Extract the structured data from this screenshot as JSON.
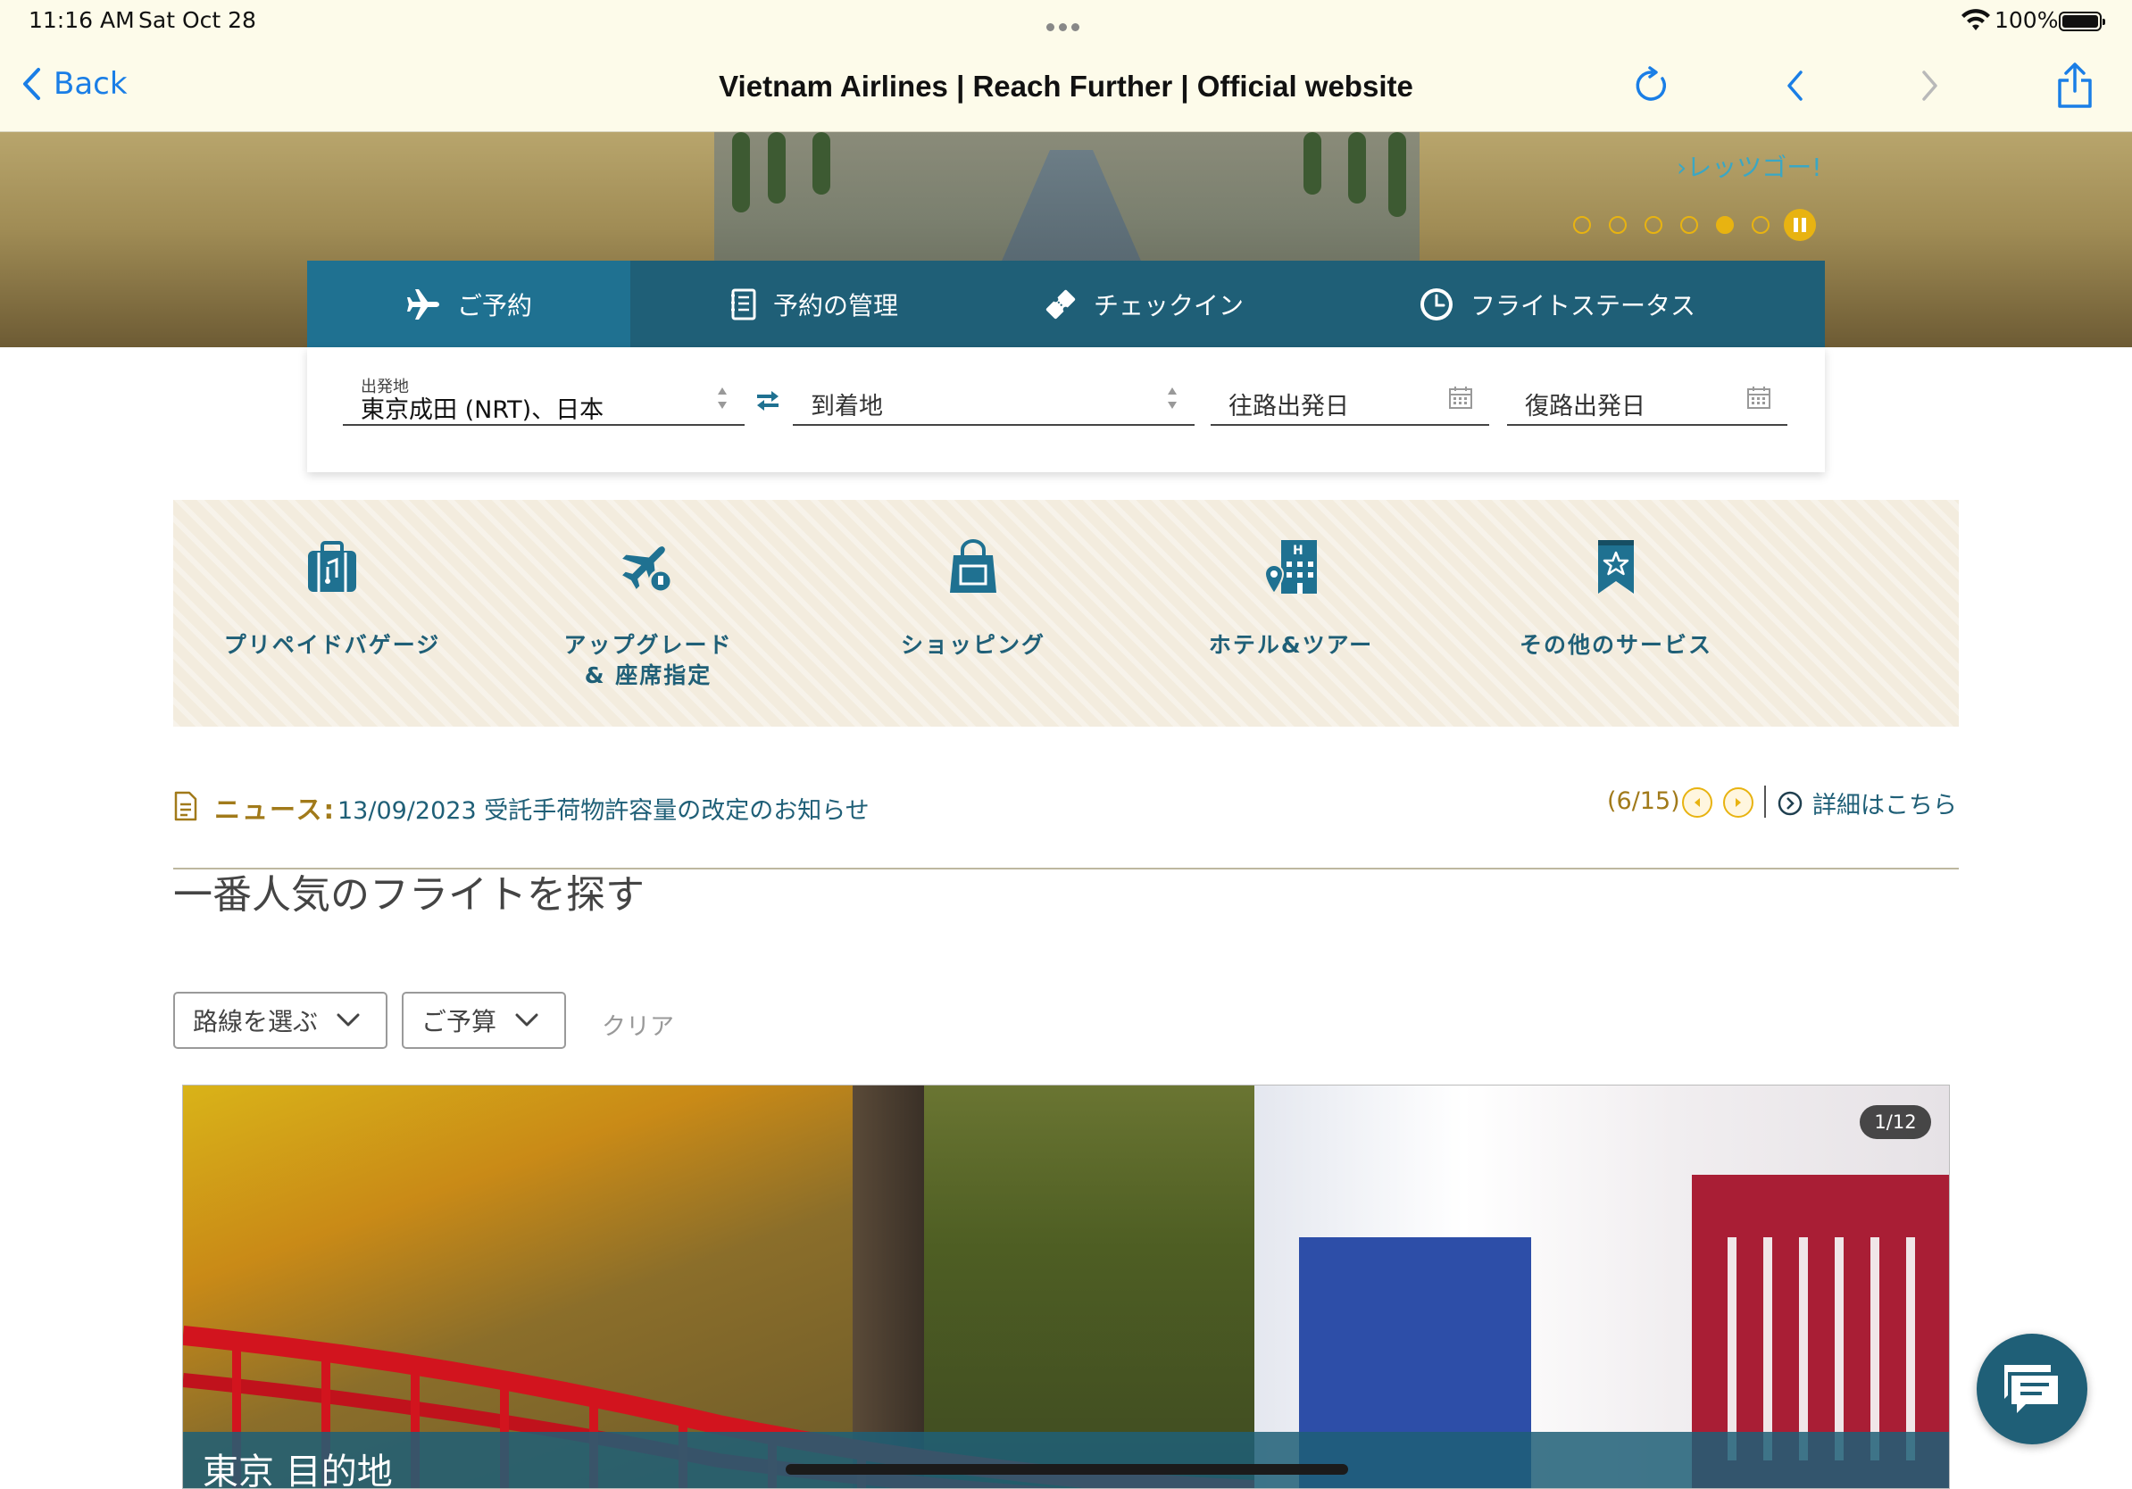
{
  "status_bar": {
    "time": "11:16 AM",
    "date": "Sat Oct 28",
    "battery": "100%"
  },
  "nav": {
    "back_label": "Back",
    "title": "Vietnam Airlines | Reach Further | Official website"
  },
  "hero": {
    "link": "›レッツゴー!",
    "slides": 6,
    "active_slide": 5
  },
  "booking_tabs": [
    {
      "label": "ご予約",
      "icon": "plane-icon"
    },
    {
      "label": "予約の管理",
      "icon": "notebook-icon"
    },
    {
      "label": "チェックイン",
      "icon": "ticket-icon"
    },
    {
      "label": "フライトステータス",
      "icon": "clock-icon"
    }
  ],
  "booking_form": {
    "origin_label": "出発地",
    "origin_value": "東京成田 (NRT)、日本",
    "destination_placeholder": "到着地",
    "depart_placeholder": "往路出発日",
    "return_placeholder": "復路出発日"
  },
  "services": [
    {
      "label": "プリペイドバゲージ",
      "icon": "luggage-icon"
    },
    {
      "label": "アップグレード\n& 座席指定",
      "icon": "plane-seat-icon"
    },
    {
      "label": "ショッピング",
      "icon": "shopping-bag-icon"
    },
    {
      "label": "ホテル&ツアー",
      "icon": "hotel-icon"
    },
    {
      "label": "その他のサービス",
      "icon": "star-bookmark-icon"
    }
  ],
  "news": {
    "label": "ニュース:",
    "headline": "13/09/2023 受託手荷物許容量の改定のお知らせ",
    "count": "(6/15)",
    "more": "詳細はこちら"
  },
  "popular": {
    "title": "一番人気のフライトを探す",
    "route_filter": "路線を選ぶ",
    "budget_filter": "ご予算",
    "clear": "クリア"
  },
  "destination_card": {
    "counter": "1/12",
    "caption": "東京 目的地"
  },
  "colors": {
    "primary": "#1f5f77",
    "primary_active": "#1f7191",
    "gold": "#e8b311",
    "news_gold": "#a17a1a",
    "ios_blue": "#1a7ee6"
  }
}
